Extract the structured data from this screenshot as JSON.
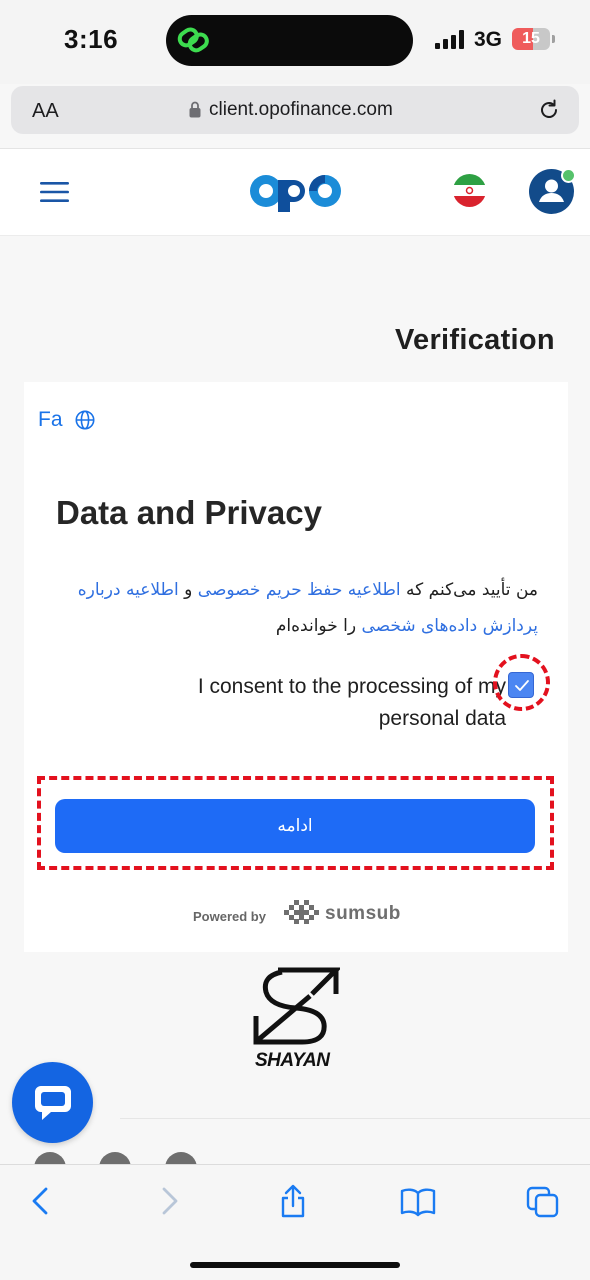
{
  "status_bar": {
    "time": "3:16",
    "network": "3G",
    "battery": "15",
    "battery_level_pct": 15
  },
  "browser": {
    "text_size_label": "AA",
    "url": "client.opofinance.com"
  },
  "header": {
    "language_flag": "iran-flag"
  },
  "page": {
    "title": "Verification"
  },
  "card": {
    "language": "Fa",
    "heading": "Data and Privacy",
    "fa_statement": {
      "prefix": "من تأیید می‌کنم که ",
      "link_privacy": "اطلاعیه حفظ حریم خصوصی",
      "joiner": " و ",
      "link_processing": "اطلاعیه درباره پردازش داده‌های شخصی",
      "suffix": " را خوانده‌ام"
    },
    "consent_text": "I consent to the processing of my personal data",
    "consent_checked": true,
    "continue_label": "ادامه",
    "powered_by": "Powered by",
    "provider": "sumsub"
  },
  "watermark": {
    "text": "SHAYAN"
  },
  "colors": {
    "primary": "#1e6bf6",
    "link": "#2f6fe0",
    "annotation": "#e3111e",
    "avatar": "#124b8a"
  }
}
